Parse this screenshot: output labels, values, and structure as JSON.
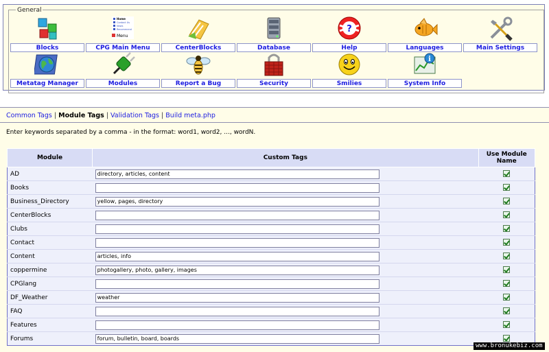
{
  "general": {
    "legend": "General",
    "row1": [
      {
        "label": "Blocks",
        "icon": "blocks-icon"
      },
      {
        "label": "CPG Main Menu",
        "icon": "menu-icon"
      },
      {
        "label": "CenterBlocks",
        "icon": "centerblocks-icon"
      },
      {
        "label": "Database",
        "icon": "database-icon"
      },
      {
        "label": "Help",
        "icon": "help-icon"
      },
      {
        "label": "Languages",
        "icon": "languages-icon"
      },
      {
        "label": "Main Settings",
        "icon": "settings-icon"
      }
    ],
    "row2": [
      {
        "label": "Metatag Manager",
        "icon": "globe-icon"
      },
      {
        "label": "Modules",
        "icon": "plug-icon"
      },
      {
        "label": "Report a Bug",
        "icon": "bug-icon"
      },
      {
        "label": "Security",
        "icon": "lock-icon"
      },
      {
        "label": "Smilies",
        "icon": "smiley-icon"
      },
      {
        "label": "System Info",
        "icon": "system-info-icon"
      }
    ],
    "menu_icon_text": [
      "Home",
      "Contact Us",
      "News",
      "Recommend",
      "Menu"
    ]
  },
  "tabs": {
    "common": "Common Tags",
    "module": "Module Tags",
    "validation": "Validation Tags",
    "build": "Build meta.php",
    "sep": "|"
  },
  "instructions": "Enter keywords separated by a comma - in the format: word1, word2, ..., wordN.",
  "table": {
    "headers": {
      "module": "Module",
      "tags": "Custom Tags",
      "use": "Use Module Name"
    },
    "rows": [
      {
        "module": "AD",
        "tags": "directory, articles, content",
        "use": true
      },
      {
        "module": "Books",
        "tags": "",
        "use": true
      },
      {
        "module": "Business_Directory",
        "tags": "yellow, pages, directory",
        "use": true
      },
      {
        "module": "CenterBlocks",
        "tags": "",
        "use": true
      },
      {
        "module": "Clubs",
        "tags": "",
        "use": true
      },
      {
        "module": "Contact",
        "tags": "",
        "use": true
      },
      {
        "module": "Content",
        "tags": "articles, info",
        "use": true
      },
      {
        "module": "coppermine",
        "tags": "photogallery, photo, gallery, images",
        "use": true
      },
      {
        "module": "CPGlang",
        "tags": "",
        "use": true
      },
      {
        "module": "DF_Weather",
        "tags": "weather",
        "use": true
      },
      {
        "module": "FAQ",
        "tags": "",
        "use": true
      },
      {
        "module": "Features",
        "tags": "",
        "use": true
      },
      {
        "module": "Forums",
        "tags": "forum, bulletin, board, boards",
        "use": true
      }
    ]
  },
  "watermark": "www.bronukebiz.com"
}
